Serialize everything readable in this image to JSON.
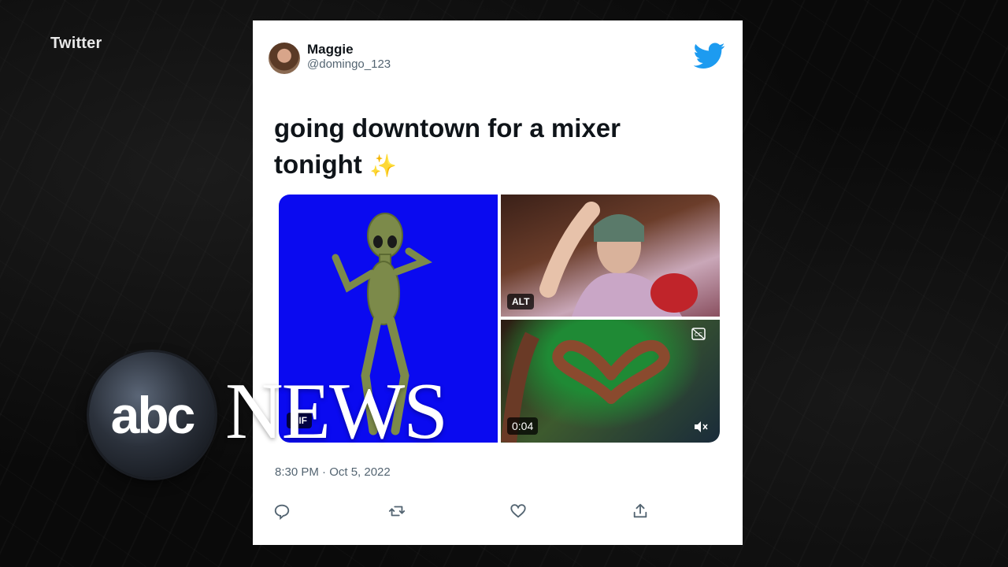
{
  "source_label": "Twitter",
  "tweet": {
    "display_name": "Maggie",
    "handle": "@domingo_123",
    "text_line1": "going downtown for a mixer",
    "text_line2": "tonight",
    "emoji": "✨",
    "timestamp": "8:30 PM · Oct 5, 2022",
    "media": {
      "gif_badge": "GIF",
      "alt_badge": "ALT",
      "video_timer": "0:04"
    },
    "actions": [
      "reply-icon",
      "retweet-icon",
      "like-icon",
      "share-icon"
    ]
  },
  "watermark": {
    "abc": "abc",
    "news": "NEWS"
  },
  "colors": {
    "twitter_blue": "#1d9bf0",
    "gif_background": "#0a0af0"
  }
}
